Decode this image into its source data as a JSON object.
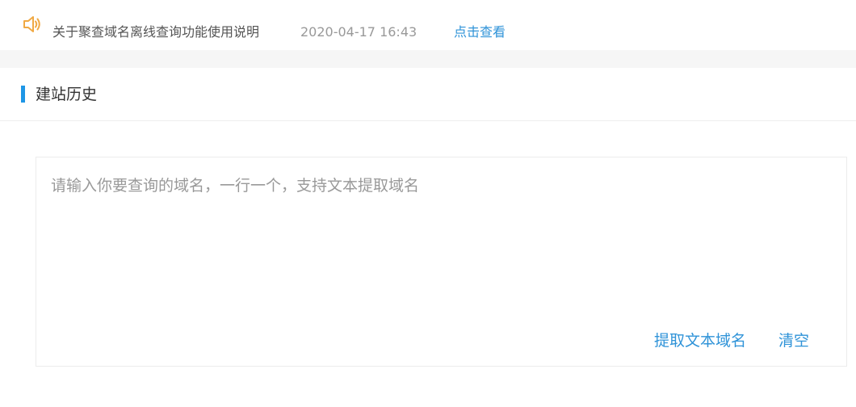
{
  "notice": {
    "icon": "speaker-icon",
    "icon_color": "#f0a944",
    "title": "关于聚查域名离线查询功能使用说明",
    "time": "2020-04-17 16:43",
    "link_label": "点击查看",
    "link_color": "#2f93d8"
  },
  "section": {
    "title": "建站历史",
    "accent_color": "#1e96e6"
  },
  "query": {
    "placeholder": "请输入你要查询的域名，一行一个，支持文本提取域名",
    "value": "",
    "extract_label": "提取文本域名",
    "clear_label": "清空"
  }
}
